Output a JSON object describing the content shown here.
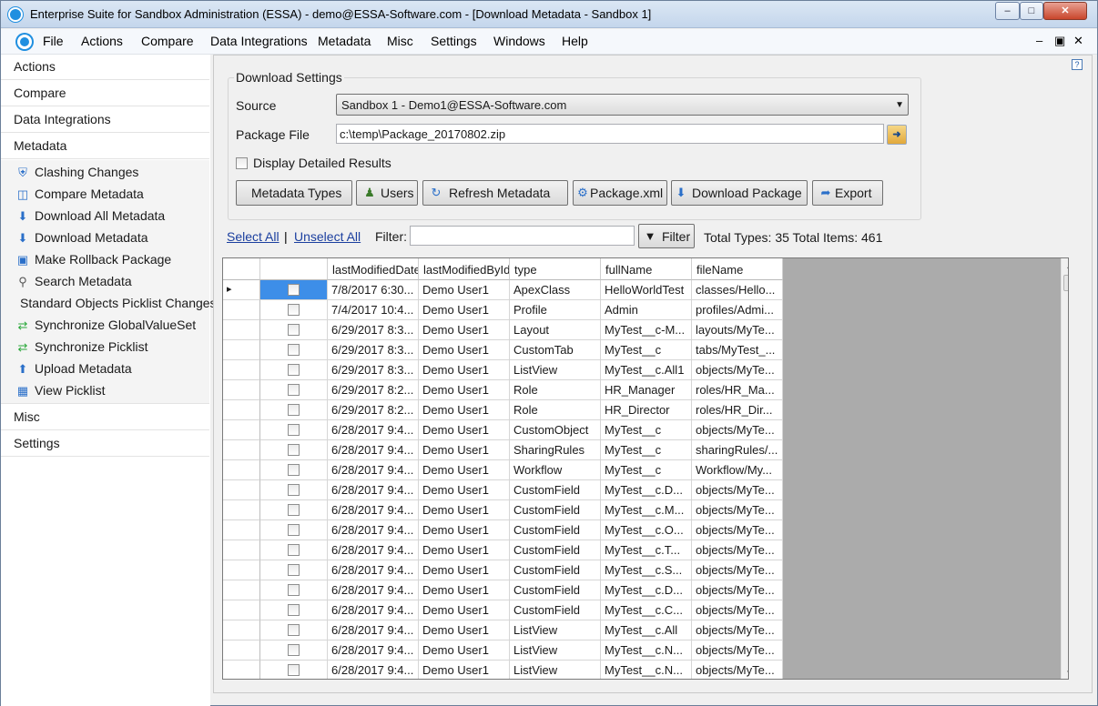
{
  "window": {
    "title": "Enterprise Suite for Sandbox Administration (ESSA) - demo@ESSA-Software.com - [Download Metadata - Sandbox 1]",
    "minimize": "–",
    "maximize": "□",
    "close": "✕"
  },
  "menubar": {
    "items": [
      "File",
      "Actions",
      "Compare",
      "Data Integrations",
      "Metadata",
      "Misc",
      "Settings",
      "Windows",
      "Help"
    ],
    "mdi_min": "–",
    "mdi_restore": "▣",
    "mdi_close": "✕"
  },
  "sidebar": {
    "headers_top": [
      "Actions",
      "Compare",
      "Data Integrations",
      "Metadata"
    ],
    "items": [
      {
        "label": "Clashing Changes",
        "icon": "shield-icon"
      },
      {
        "label": "Compare Metadata",
        "icon": "compare-columns-icon"
      },
      {
        "label": "Download All Metadata",
        "icon": "download-box-icon"
      },
      {
        "label": "Download Metadata",
        "icon": "download-box-icon"
      },
      {
        "label": "Make Rollback Package",
        "icon": "package-icon"
      },
      {
        "label": "Search Metadata",
        "icon": "search-icon"
      },
      {
        "label": "Standard Objects Picklist Changes",
        "icon": ""
      },
      {
        "label": "Synchronize GlobalValueSet",
        "icon": "sync-arrows-icon"
      },
      {
        "label": "Synchronize Picklist",
        "icon": "sync-arrows-icon"
      },
      {
        "label": "Upload Metadata",
        "icon": "upload-box-icon"
      },
      {
        "label": "View Picklist",
        "icon": "table-icon"
      }
    ],
    "headers_bottom": [
      "Misc",
      "Settings"
    ]
  },
  "download_settings": {
    "legend": "Download Settings",
    "source_label": "Source",
    "source_value": "Sandbox 1 - Demo1@ESSA-Software.com",
    "package_label": "Package File",
    "package_value": "c:\\temp\\Package_20170802.zip",
    "detailed_label": "Display Detailed Results",
    "detailed_checked": false
  },
  "buttons": {
    "metadata_types": "Metadata Types",
    "users": "Users",
    "refresh": "Refresh Metadata",
    "package_xml": "Package.xml",
    "download_package": "Download Package",
    "export": "Export"
  },
  "filter_bar": {
    "select_all": "Select All",
    "separator": "|",
    "unselect_all": "Unselect All",
    "filter_label": "Filter:",
    "filter_value": "",
    "filter_button": "Filter",
    "totals": "Total Types: 35 Total Items: 461"
  },
  "grid": {
    "columns": [
      "lastModifiedDate",
      "lastModifiedById",
      "type",
      "fullName",
      "fileName"
    ],
    "rows": [
      [
        "7/8/2017 6:30...",
        "Demo User1",
        "ApexClass",
        "HelloWorldTest",
        "classes/Hello..."
      ],
      [
        "7/4/2017 10:4...",
        "Demo User1",
        "Profile",
        "Admin",
        "profiles/Admi..."
      ],
      [
        "6/29/2017 8:3...",
        "Demo User1",
        "Layout",
        "MyTest__c-M...",
        "layouts/MyTe..."
      ],
      [
        "6/29/2017 8:3...",
        "Demo User1",
        "CustomTab",
        "MyTest__c",
        "tabs/MyTest_..."
      ],
      [
        "6/29/2017 8:3...",
        "Demo User1",
        "ListView",
        "MyTest__c.All1",
        "objects/MyTe..."
      ],
      [
        "6/29/2017 8:2...",
        "Demo User1",
        "Role",
        "HR_Manager",
        "roles/HR_Ma..."
      ],
      [
        "6/29/2017 8:2...",
        "Demo User1",
        "Role",
        "HR_Director",
        "roles/HR_Dir..."
      ],
      [
        "6/28/2017 9:4...",
        "Demo User1",
        "CustomObject",
        "MyTest__c",
        "objects/MyTe..."
      ],
      [
        "6/28/2017 9:4...",
        "Demo User1",
        "SharingRules",
        "MyTest__c",
        "sharingRules/..."
      ],
      [
        "6/28/2017 9:4...",
        "Demo User1",
        "Workflow",
        "MyTest__c",
        "Workflow/My..."
      ],
      [
        "6/28/2017 9:4...",
        "Demo User1",
        "CustomField",
        "MyTest__c.D...",
        "objects/MyTe..."
      ],
      [
        "6/28/2017 9:4...",
        "Demo User1",
        "CustomField",
        "MyTest__c.M...",
        "objects/MyTe..."
      ],
      [
        "6/28/2017 9:4...",
        "Demo User1",
        "CustomField",
        "MyTest__c.O...",
        "objects/MyTe..."
      ],
      [
        "6/28/2017 9:4...",
        "Demo User1",
        "CustomField",
        "MyTest__c.T...",
        "objects/MyTe..."
      ],
      [
        "6/28/2017 9:4...",
        "Demo User1",
        "CustomField",
        "MyTest__c.S...",
        "objects/MyTe..."
      ],
      [
        "6/28/2017 9:4...",
        "Demo User1",
        "CustomField",
        "MyTest__c.D...",
        "objects/MyTe..."
      ],
      [
        "6/28/2017 9:4...",
        "Demo User1",
        "CustomField",
        "MyTest__c.C...",
        "objects/MyTe..."
      ],
      [
        "6/28/2017 9:4...",
        "Demo User1",
        "ListView",
        "MyTest__c.All",
        "objects/MyTe..."
      ],
      [
        "6/28/2017 9:4...",
        "Demo User1",
        "ListView",
        "MyTest__c.N...",
        "objects/MyTe..."
      ],
      [
        "6/28/2017 9:4...",
        "Demo User1",
        "ListView",
        "MyTest__c.N...",
        "objects/MyTe..."
      ]
    ],
    "selected_row": 0,
    "current_row_marker": "▸"
  },
  "colors": {
    "selection": "#3d8ee8",
    "link": "#1b3f9f",
    "title_gradient_top": "#dbe7f4"
  }
}
